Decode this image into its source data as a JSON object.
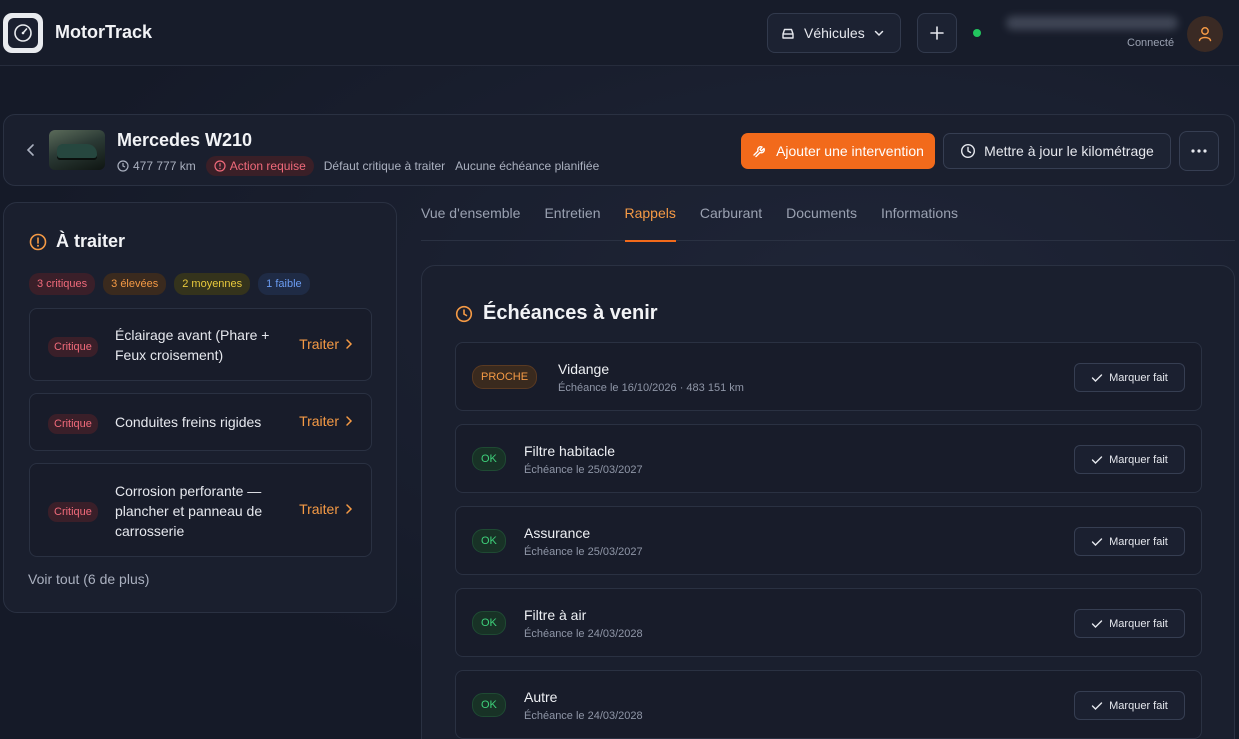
{
  "header": {
    "app_name": "MotorTrack",
    "vehicles_label": "Véhicules",
    "user_status": "Connecté",
    "icons": {
      "logo": "speedometer-icon",
      "vehicles": "car-icon",
      "add": "plus-icon",
      "user": "user-icon"
    },
    "colors": {
      "online_dot": "#22c55e",
      "accent": "#f26a1b"
    }
  },
  "vehicle": {
    "name": "Mercedes W210",
    "mileage": "477 777 km",
    "action_label": "Action requise",
    "critical_note": "Défaut critique à traiter",
    "schedule_note": "Aucune échéance planifiée",
    "add_intervention_label": "Ajouter une intervention",
    "update_mileage_label": "Mettre à jour le kilométrage"
  },
  "todo": {
    "title": "À traiter",
    "badges": {
      "critical": "3 critiques",
      "high": "3 élevées",
      "medium": "2 moyennes",
      "low": "1 faible"
    },
    "items": [
      {
        "severity": "Critique",
        "label": "Éclairage avant (Phare + Feux croisement)",
        "action": "Traiter"
      },
      {
        "severity": "Critique",
        "label": "Conduites freins rigides",
        "action": "Traiter"
      },
      {
        "severity": "Critique",
        "label": "Corrosion perforante — plancher et panneau de carrosserie",
        "action": "Traiter"
      }
    ],
    "see_all": "Voir tout (6 de plus)"
  },
  "tabs": [
    {
      "label": "Vue d'ensemble",
      "active": false
    },
    {
      "label": "Entretien",
      "active": false
    },
    {
      "label": "Rappels",
      "active": true
    },
    {
      "label": "Carburant",
      "active": false
    },
    {
      "label": "Documents",
      "active": false
    },
    {
      "label": "Informations",
      "active": false
    }
  ],
  "reminders": {
    "title": "Échéances à venir",
    "mark_done_label": "Marquer fait",
    "items": [
      {
        "status": "PROCHE",
        "title": "Vidange",
        "due": "Échéance le 16/10/2026 · 483 151 km"
      },
      {
        "status": "OK",
        "title": "Filtre habitacle",
        "due": "Échéance le 25/03/2027"
      },
      {
        "status": "OK",
        "title": "Assurance",
        "due": "Échéance le 25/03/2027"
      },
      {
        "status": "OK",
        "title": "Filtre à air",
        "due": "Échéance le 24/03/2028"
      },
      {
        "status": "OK",
        "title": "Autre",
        "due": "Échéance le 24/03/2028"
      }
    ]
  }
}
